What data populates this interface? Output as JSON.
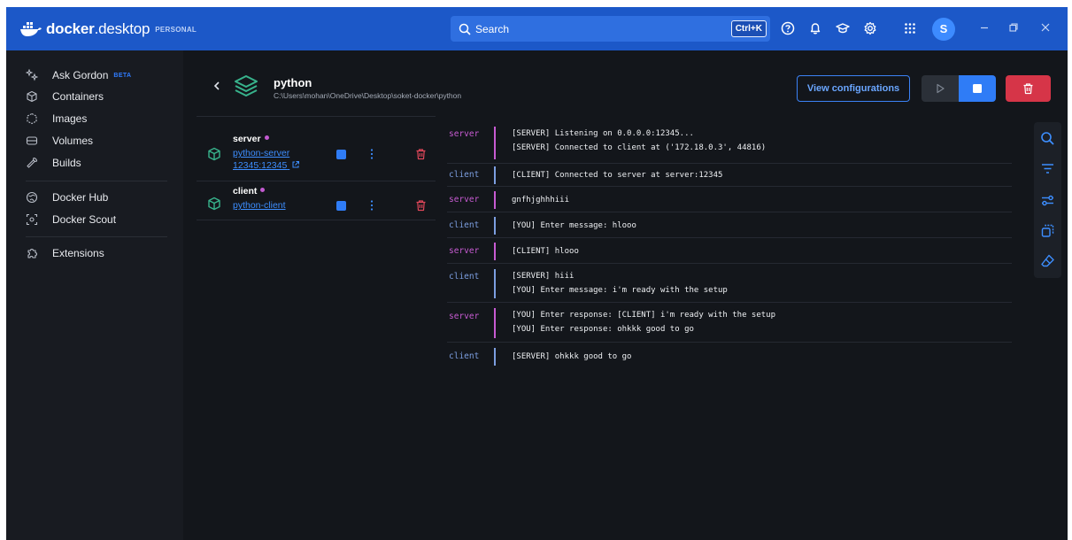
{
  "app": {
    "logo_docker": "docker",
    "logo_desktop": ".desktop",
    "plan": "PERSONAL",
    "search_label": "Search",
    "search_shortcut": "Ctrl+K",
    "avatar_initial": "S",
    "accent_color": "#1c58c8"
  },
  "sidebar": {
    "items": [
      {
        "label": "Ask Gordon",
        "badge": "BETA",
        "icon": "sparkle-icon"
      },
      {
        "label": "Containers",
        "icon": "containers-icon"
      },
      {
        "label": "Images",
        "icon": "images-icon"
      },
      {
        "label": "Volumes",
        "icon": "volumes-icon"
      },
      {
        "label": "Builds",
        "icon": "builds-icon"
      },
      {
        "label": "Docker Hub",
        "icon": "docker-hub-icon"
      },
      {
        "label": "Docker Scout",
        "icon": "docker-scout-icon"
      },
      {
        "label": "Extensions",
        "icon": "extensions-icon"
      }
    ]
  },
  "project": {
    "name": "python",
    "path": "C:\\Users\\mohan\\OneDrive\\Desktop\\soket-docker\\python",
    "view_config_label": "View configurations"
  },
  "containers": [
    {
      "name": "server",
      "image": "python-server",
      "port": "12345:12345",
      "status_color": "#c35ad0"
    },
    {
      "name": "client",
      "image": "python-client",
      "port": "",
      "status_color": "#c35ad0"
    }
  ],
  "logs": [
    {
      "source": "server",
      "lines": [
        "[SERVER] Listening on 0.0.0.0:12345...",
        "[SERVER] Connected to client at ('172.18.0.3', 44816)"
      ]
    },
    {
      "source": "client",
      "lines": [
        "[CLIENT] Connected to server at server:12345"
      ]
    },
    {
      "source": "server",
      "lines": [
        "gnfhjghhhiii"
      ]
    },
    {
      "source": "client",
      "lines": [
        "[YOU] Enter message: hlooo"
      ]
    },
    {
      "source": "server",
      "lines": [
        "[CLIENT] hlooo"
      ]
    },
    {
      "source": "client",
      "lines": [
        "[SERVER] hiii",
        "[YOU] Enter message: i'm ready with the setup"
      ]
    },
    {
      "source": "server",
      "lines": [
        "[YOU] Enter response: [CLIENT] i'm ready with the setup",
        "[YOU] Enter response: ohkkk good to go"
      ]
    },
    {
      "source": "client",
      "lines": [
        "[SERVER] ohkkk good to go"
      ]
    }
  ]
}
